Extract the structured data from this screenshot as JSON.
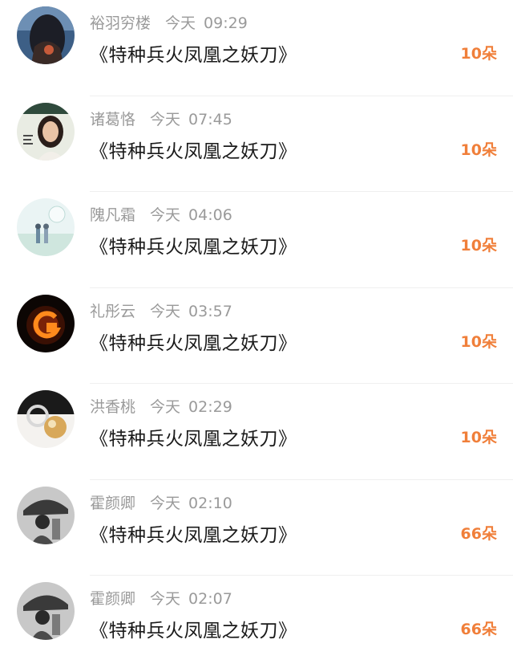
{
  "colors": {
    "accent": "#f07f3a",
    "meta_text": "#9a9a9a",
    "title_text": "#1a1a1a"
  },
  "items": [
    {
      "avatar": "avatar-anime-girl-back",
      "name": "裕羽穷楼",
      "day": "今天",
      "time": "09:29",
      "title": "《特种兵火凤凰之妖刀》",
      "amount": "10朵"
    },
    {
      "avatar": "avatar-woman-poster",
      "name": "诸葛恪",
      "day": "今天",
      "time": "07:45",
      "title": "《特种兵火凤凰之妖刀》",
      "amount": "10朵"
    },
    {
      "avatar": "avatar-anime-couple",
      "name": "隗凡霜",
      "day": "今天",
      "time": "04:06",
      "title": "《特种兵火凤凰之妖刀》",
      "amount": "10朵"
    },
    {
      "avatar": "avatar-fire-letter-g",
      "name": "礼彤云",
      "day": "今天",
      "time": "03:57",
      "title": "《特种兵火凤凰之妖刀》",
      "amount": "10朵"
    },
    {
      "avatar": "avatar-pearl-ring",
      "name": "洪香桃",
      "day": "今天",
      "time": "02:29",
      "title": "《特种兵火凤凰之妖刀》",
      "amount": "10朵"
    },
    {
      "avatar": "avatar-bw-photo",
      "name": "霍颜卿",
      "day": "今天",
      "time": "02:10",
      "title": "《特种兵火凤凰之妖刀》",
      "amount": "66朵"
    },
    {
      "avatar": "avatar-bw-photo",
      "name": "霍颜卿",
      "day": "今天",
      "time": "02:07",
      "title": "《特种兵火凤凰之妖刀》",
      "amount": "66朵"
    }
  ]
}
